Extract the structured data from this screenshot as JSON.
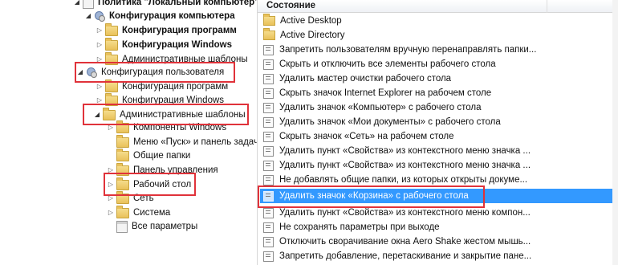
{
  "tree": {
    "items": [
      {
        "label": "Политика \"Локальный компьютер\"",
        "bold": true,
        "arrow": "open",
        "icon": "computer-policy-icon"
      },
      {
        "label": "Конфигурация компьютера",
        "bold": true,
        "arrow": "open",
        "icon": "computer-config-icon"
      },
      {
        "label": "Конфигурация программ",
        "bold": true,
        "arrow": "closed",
        "icon": "folder-icon"
      },
      {
        "label": "Конфигурация Windows",
        "bold": true,
        "arrow": "closed",
        "icon": "folder-icon"
      },
      {
        "label": "Административные шаблоны",
        "bold": false,
        "arrow": "closed",
        "icon": "folder-icon"
      },
      {
        "label": "Конфигурация пользователя",
        "bold": false,
        "arrow": "open",
        "icon": "user-config-icon"
      },
      {
        "label": "Конфигурация программ",
        "bold": false,
        "arrow": "closed",
        "icon": "folder-icon"
      },
      {
        "label": "Конфигурация Windows",
        "bold": false,
        "arrow": "closed",
        "icon": "folder-icon"
      },
      {
        "label": "Административные шаблоны",
        "bold": false,
        "arrow": "open",
        "icon": "folder-icon"
      },
      {
        "label": "Компоненты Windows",
        "bold": false,
        "arrow": "closed",
        "icon": "folder-icon"
      },
      {
        "label": "Меню «Пуск» и панель задач",
        "bold": false,
        "arrow": "none",
        "icon": "folder-icon"
      },
      {
        "label": "Общие папки",
        "bold": false,
        "arrow": "none",
        "icon": "folder-icon"
      },
      {
        "label": "Панель управления",
        "bold": false,
        "arrow": "closed",
        "icon": "folder-icon"
      },
      {
        "label": "Рабочий стол",
        "bold": false,
        "arrow": "closed",
        "icon": "folder-icon"
      },
      {
        "label": "Сеть",
        "bold": false,
        "arrow": "closed",
        "icon": "folder-icon"
      },
      {
        "label": "Система",
        "bold": false,
        "arrow": "closed",
        "icon": "folder-icon"
      },
      {
        "label": "Все параметры",
        "bold": false,
        "arrow": "none",
        "icon": "all-settings-icon"
      }
    ]
  },
  "list": {
    "column_header": "Состояние",
    "items": [
      {
        "label": "Active Desktop",
        "kind": "folder"
      },
      {
        "label": "Active Directory",
        "kind": "folder"
      },
      {
        "label": "Запретить пользователям вручную перенаправлять папки...",
        "kind": "setting"
      },
      {
        "label": "Скрыть и отключить все элементы рабочего стола",
        "kind": "setting"
      },
      {
        "label": "Удалить мастер очистки рабочего стола",
        "kind": "setting"
      },
      {
        "label": "Скрыть значок Internet Explorer на рабочем столе",
        "kind": "setting"
      },
      {
        "label": "Удалить значок «Компьютер» с рабочего стола",
        "kind": "setting"
      },
      {
        "label": "Удалить значок «Мои документы» с рабочего стола",
        "kind": "setting"
      },
      {
        "label": "Скрыть значок «Сеть» на рабочем столе",
        "kind": "setting"
      },
      {
        "label": "Удалить пункт «Свойства» из контекстного меню значка ...",
        "kind": "setting"
      },
      {
        "label": "Удалить пункт «Свойства» из контекстного меню значка ...",
        "kind": "setting"
      },
      {
        "label": "Не добавлять общие папки, из которых открыты докуме...",
        "kind": "setting"
      },
      {
        "label": "Удалить значок «Корзина» с рабочего стола",
        "kind": "setting",
        "selected": true
      },
      {
        "label": "Удалить пункт «Свойства» из контекстного меню компон...",
        "kind": "setting"
      },
      {
        "label": "Не сохранять параметры при выходе",
        "kind": "setting"
      },
      {
        "label": "Отключить сворачивание окна Aero Shake жестом мышь...",
        "kind": "setting"
      },
      {
        "label": "Запретить добавление, перетаскивание и закрытие пане...",
        "kind": "setting"
      }
    ]
  },
  "colors": {
    "selection": "#3399ff",
    "highlight_box": "#e0323a"
  }
}
